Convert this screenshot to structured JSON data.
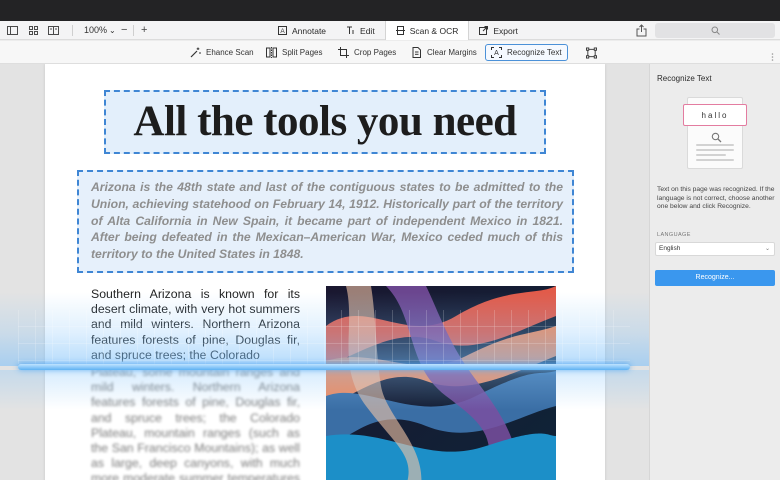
{
  "toolbar": {
    "zoom": "100%",
    "zoom_out": "−",
    "zoom_in": "+",
    "tabs": [
      {
        "label": "Annotate",
        "active": false
      },
      {
        "label": "Edit",
        "active": false
      },
      {
        "label": "Scan & OCR",
        "active": true
      },
      {
        "label": "Export",
        "active": false
      }
    ]
  },
  "subtoolbar": {
    "tools": [
      {
        "label": "Ehance Scan",
        "active": false
      },
      {
        "label": "Split Pages",
        "active": false
      },
      {
        "label": "Crop Pages",
        "active": false
      },
      {
        "label": "Clear Margins",
        "active": false
      },
      {
        "label": "Recognize Text",
        "active": true
      }
    ]
  },
  "document": {
    "heading": "All the tools you need",
    "intro_paragraph": "Arizona is the 48th state and last of the contiguous states to be admitted to the Union, achieving statehood on February 14, 1912. Historically part of the territory of Alta California in New Spain, it became part of independent Mexico in 1821. After being defeated in the Mexican–American War, Mexico ceded much of this territory to the United States in 1848.",
    "column_text": "Southern Arizona is known for its desert climate, with very hot summers and mild winters. Northern Arizona features forests of pine, Douglas fir, and spruce trees; the Colorado",
    "column_text_blurred": "Plateau, some mountain ranges and mild winters. Northern Arizona features forests of pine, Douglas fir, and spruce trees; the Colorado Plateau, mountain ranges (such as the San Francisco Mountains); as well as large, deep canyons, with much more moderate summer temperatures and significant winter snowfalls. There are"
  },
  "panel": {
    "title": "Recognize Text",
    "illustration_text": "hallo",
    "description": "Text on this page was recognized. If the language is not correct, choose another one below and click Recognize.",
    "language_label": "LANGUAGE",
    "language_value": "English",
    "recognize_button": "Recognize..."
  },
  "colors": {
    "accent": "#3a97ee",
    "selection_border": "#3f86d4",
    "titlebar": "#232325"
  }
}
